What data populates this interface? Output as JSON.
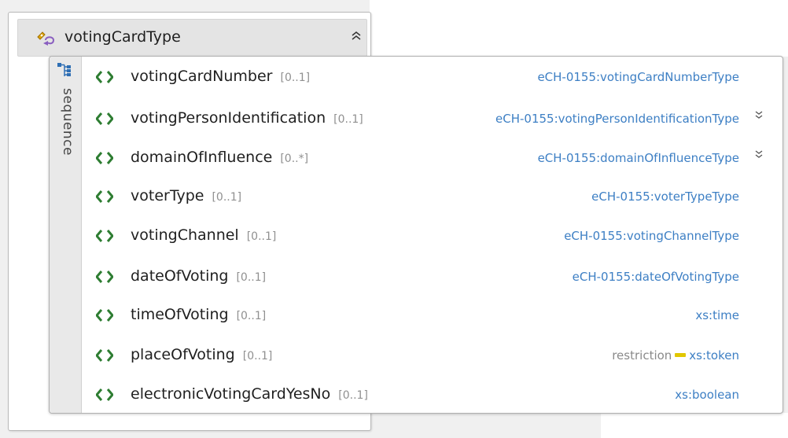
{
  "complex_type": {
    "name": "votingCardType",
    "collapse_glyph": "≈",
    "icon": "complex-type-icon"
  },
  "compositor": {
    "label": "sequence",
    "icon": "sequence-icon"
  },
  "elements": [
    {
      "name": "votingCardNumber",
      "cardinality": "[0..1]",
      "type": "eCH-0155:votingCardNumberType",
      "expandable": false
    },
    {
      "name": "votingPersonIdentification",
      "cardinality": "[0..1]",
      "type": "eCH-0155:votingPersonIdentificationType",
      "expandable": true
    },
    {
      "name": "domainOfInfluence",
      "cardinality": "[0..*]",
      "type": "eCH-0155:domainOfInfluenceType",
      "expandable": true
    },
    {
      "name": "voterType",
      "cardinality": "[0..1]",
      "type": "eCH-0155:voterTypeType",
      "expandable": false
    },
    {
      "name": "votingChannel",
      "cardinality": "[0..1]",
      "type": "eCH-0155:votingChannelType",
      "expandable": false
    },
    {
      "name": "dateOfVoting",
      "cardinality": "[0..1]",
      "type": "eCH-0155:dateOfVotingType",
      "expandable": false
    },
    {
      "name": "timeOfVoting",
      "cardinality": "[0..1]",
      "type": "xs:time",
      "expandable": false
    },
    {
      "name": "placeOfVoting",
      "cardinality": "[0..1]",
      "restriction_label": "restriction",
      "type": "xs:token",
      "expandable": false
    },
    {
      "name": "electronicVotingCardYesNo",
      "cardinality": "[0..1]",
      "type": "xs:boolean",
      "expandable": false
    }
  ],
  "expand_glyph": "≫",
  "colors": {
    "type_link": "#3d7fc4",
    "element_icon": "#2e7d32",
    "restriction_marker": "#e1c700"
  }
}
